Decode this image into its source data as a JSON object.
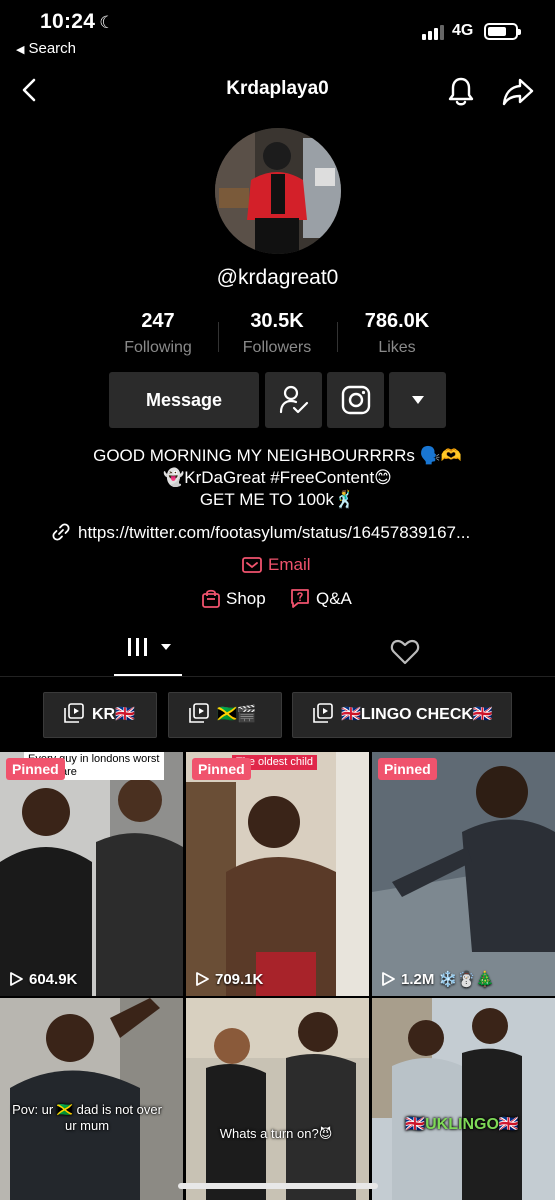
{
  "status_bar": {
    "time": "10:24",
    "back_label": "Search",
    "network": "4G"
  },
  "nav": {
    "title": "Krdaplaya0"
  },
  "profile": {
    "handle": "@krdagreat0",
    "stats": [
      {
        "value": "247",
        "label": "Following"
      },
      {
        "value": "30.5K",
        "label": "Followers"
      },
      {
        "value": "786.0K",
        "label": "Likes"
      }
    ],
    "message_label": "Message",
    "bio": [
      "GOOD MORNING MY NEIGHBOURRRRs 🗣️🫶",
      "👻KrDaGreat #FreeContent😊",
      "GET ME TO 100k🕺"
    ],
    "link": "https://twitter.com/footasylum/status/16457839167...",
    "email_label": "Email",
    "shop_label": "Shop",
    "qa_label": "Q&A"
  },
  "playlists": [
    "KR🇬🇧",
    "🇯🇲🎬",
    "🇬🇧LINGO CHECK🇬🇧"
  ],
  "videos": [
    {
      "pinned": "Pinned",
      "views": "604.9K",
      "caption": "Every guy in londons worst nightmare"
    },
    {
      "pinned": "Pinned",
      "views": "709.1K",
      "caption": "The oldest child"
    },
    {
      "pinned": "Pinned",
      "views": "1.2M ❄️☃️🎄",
      "caption": ""
    },
    {
      "pinned": "",
      "views": "",
      "caption": "Pov: ur 🇯🇲 dad is not over ur mum"
    },
    {
      "pinned": "",
      "views": "",
      "caption": "Whats a turn on?😈"
    },
    {
      "pinned": "",
      "views": "",
      "caption": "🇬🇧UKLINGO🇬🇧"
    }
  ],
  "colors": {
    "accent": "#f0536d",
    "background": "#000000",
    "button": "#2b2b2b"
  }
}
